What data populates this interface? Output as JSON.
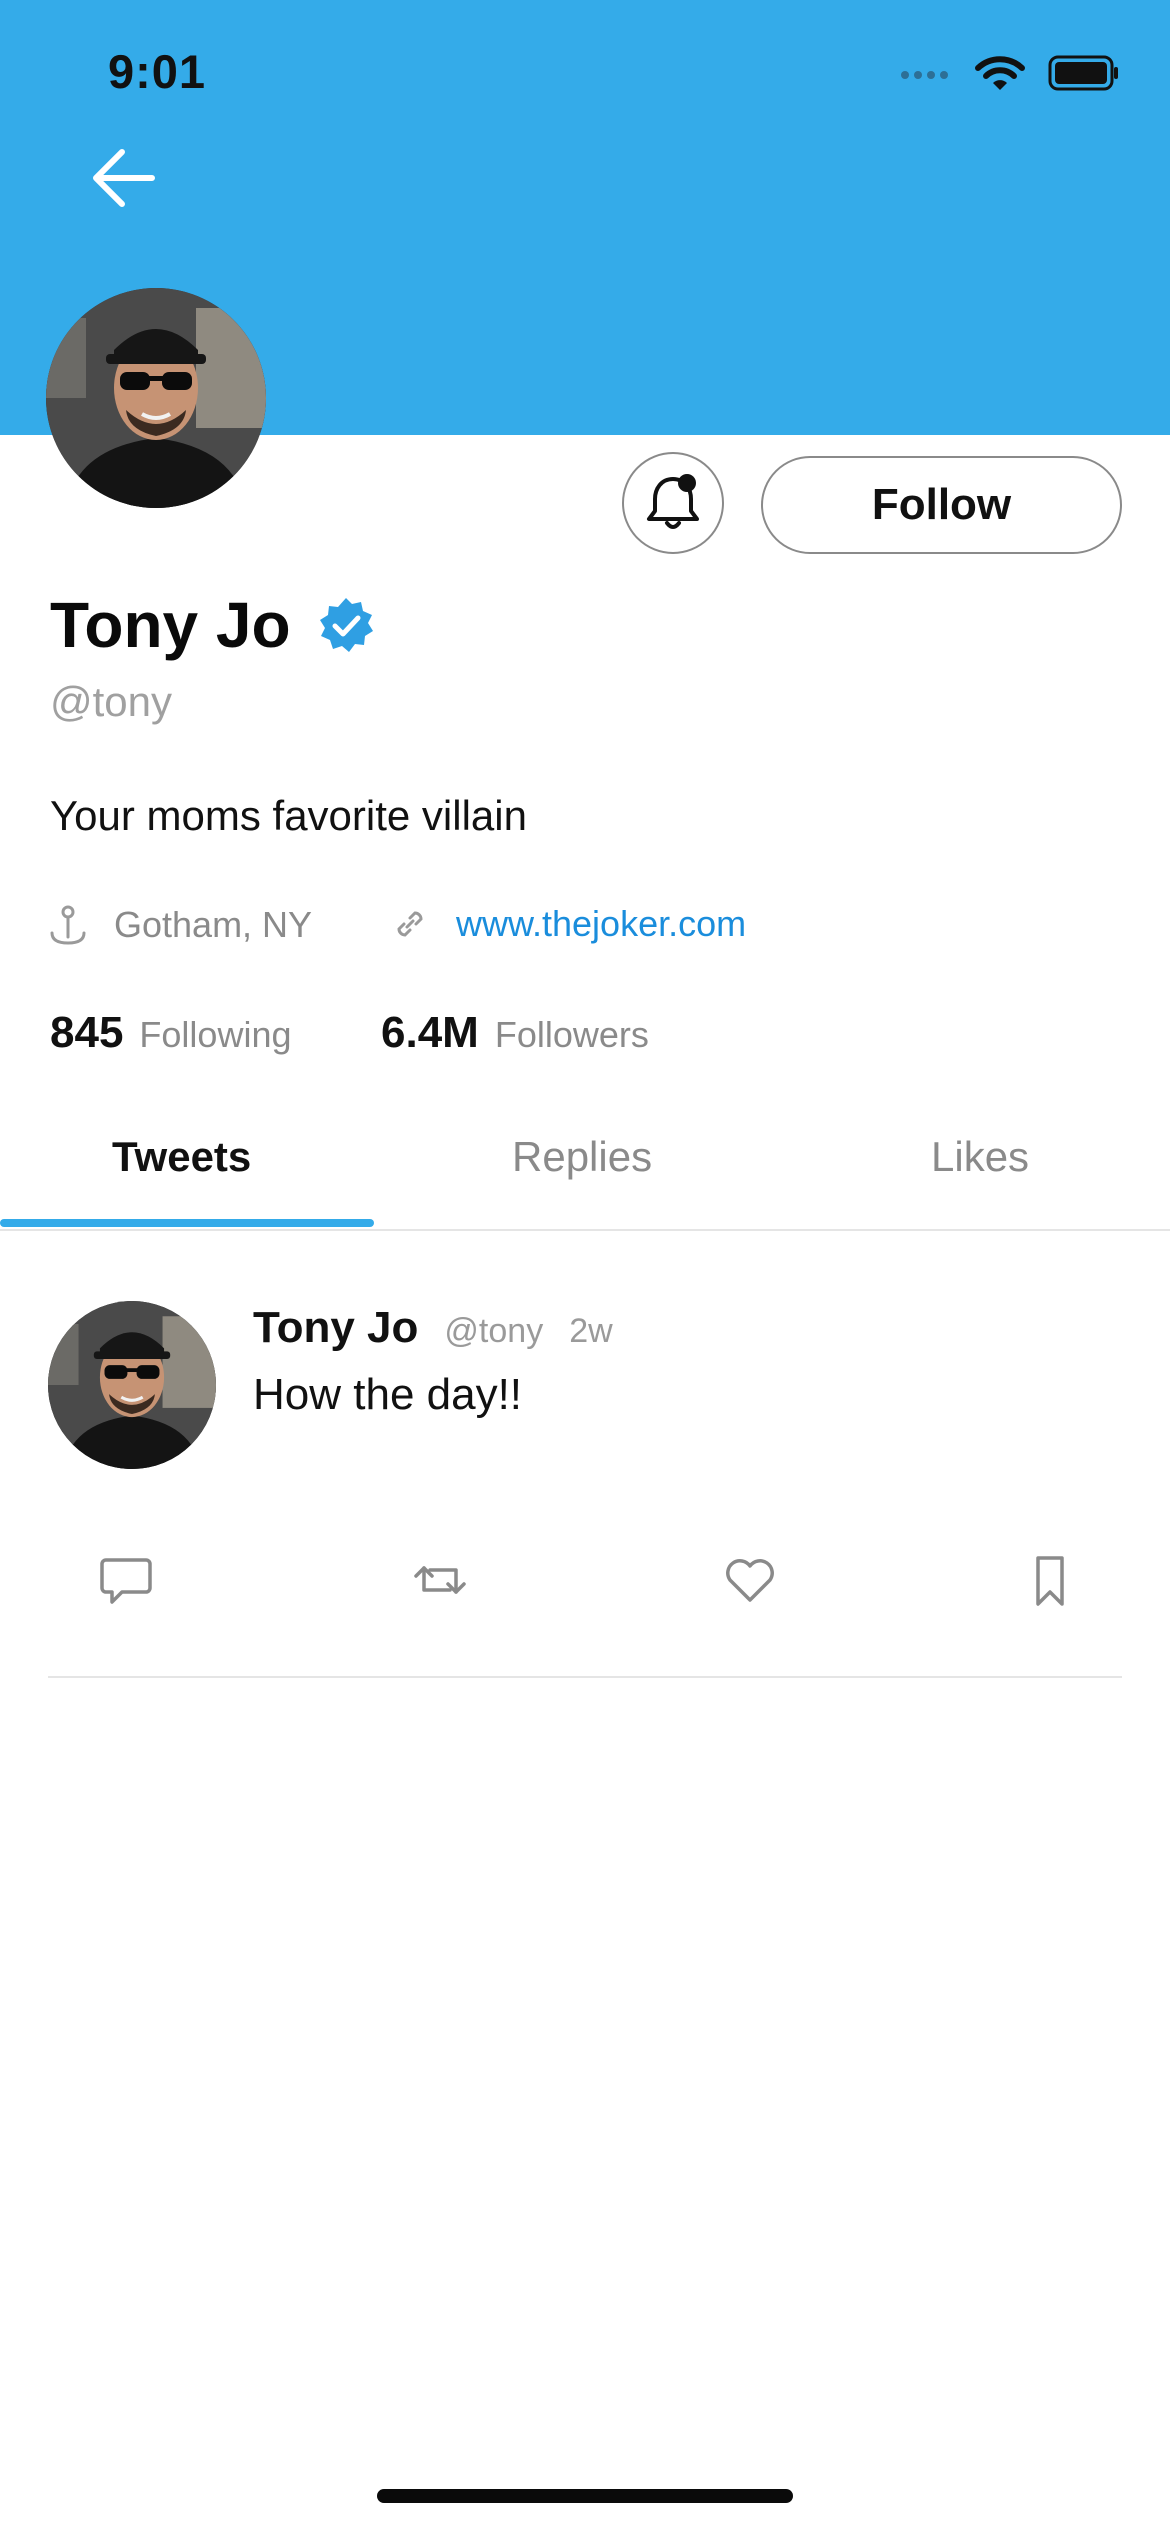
{
  "status_bar": {
    "time": "9:01"
  },
  "header": {
    "banner_color": "#34abe9",
    "back_icon": "arrow-left-icon"
  },
  "profile": {
    "name": "Tony Jo",
    "handle": "@tony",
    "bio": "Your moms favorite villain",
    "location": "Gotham, NY",
    "website": "www.thejoker.com",
    "following_count": "845",
    "following_label": "Following",
    "followers_count": "6.4M",
    "followers_label": "Followers",
    "verified": true
  },
  "actions": {
    "notify_icon": "bell-icon",
    "follow_label": "Follow"
  },
  "tabs": [
    {
      "label": "Tweets",
      "active": true
    },
    {
      "label": "Replies",
      "active": false
    },
    {
      "label": "Likes",
      "active": false
    }
  ],
  "tweets": [
    {
      "name": "Tony Jo",
      "handle": "@tony",
      "time": "2w",
      "text": "How the day!!",
      "actions": [
        "reply-icon",
        "retweet-icon",
        "like-icon",
        "bookmark-icon"
      ]
    }
  ],
  "colors": {
    "accent": "#34abe9",
    "link": "#1a8ddc",
    "muted_text": "#8a8a8a"
  }
}
